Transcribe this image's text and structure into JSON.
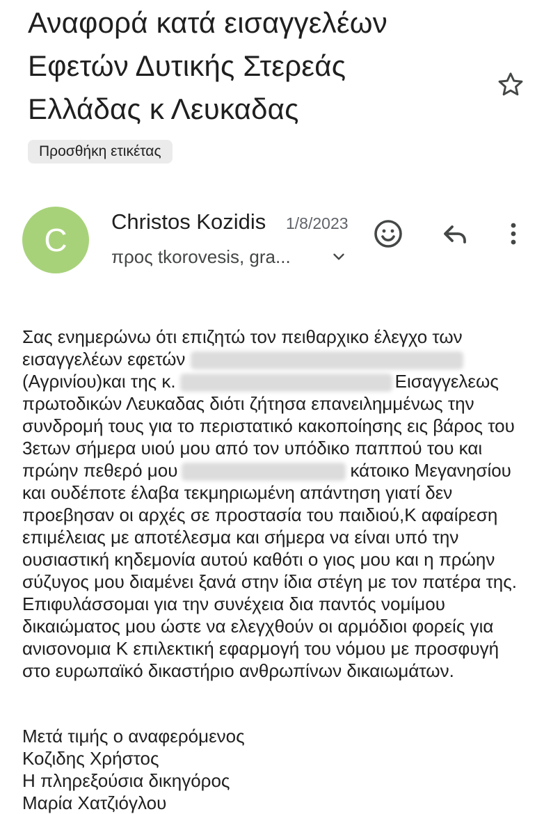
{
  "email": {
    "subject": "Αναφορά κατά εισαγγελέων Εφετών Δυτικής Στερεάς Ελλάδας κ Λευκαδας",
    "add_label": "Προσθήκη ετικέτας",
    "sender_initial": "C",
    "sender_name": "Christos Kozidis",
    "date": "1/8/2023",
    "recipients": "προς tkorovesis, gra...",
    "body": {
      "p1": "Σας ενημερώνω ότι επιζητώ τον πειθαρχικο έλεγχο των εισαγγελέων εφετών",
      "p2": "(Αγρινίου)και της κ.",
      "p3": "Εισαγγελεως πρωτοδικών Λευκαδας διότι ζήτησα επανειλημμένως την συνδρομή τους για το περιστατικό κακοποίησης εις βάρος του 3ετων  σήμερα υιού μου από τον υπόδικο παππού του και πρώην πεθερό μου",
      "p4": "κάτοικο Μεγανησίου και ουδέποτε έλαβα τεκμηριωμένη απάντηση γιατί δεν προεβησαν οι αρχές σε προστασία του παιδιού,Κ αφαίρεση επιμέλειας με αποτέλεσμα και σήμερα να είναι υπό την ουσιαστική κηδεμονία αυτού καθότι ο γιος μου και η πρώην σύζυγος μου διαμένει ξανά στην ίδια στέγη με τον πατέρα της. Επιφυλάσσομαι για την συνέχεια δια παντός νομίμου δικαιώματος μου  ώστε να ελεγχθούν οι αρμόδιοι φορείς για ανισονομια Κ  επιλεκτική εφαρμογή του νόμου με προσφυγή στο ευρωπαϊκό δικαστήριο ανθρωπίνων δικαιωμάτων."
    },
    "signature": [
      "Μετά τιμής ο αναφερόμενος",
      "Κοζιδης Χρήστος",
      "Η πληρεξούσια δικηγόρος",
      "Μαρία Χατζιόγλου"
    ]
  },
  "colors": {
    "avatar": "#a8d27a",
    "chip": "#ebebeb",
    "text": "#1f1f1f"
  },
  "icons": [
    "star-icon",
    "emoji-icon",
    "reply-icon",
    "more-vert-icon",
    "chevron-down-icon"
  ]
}
